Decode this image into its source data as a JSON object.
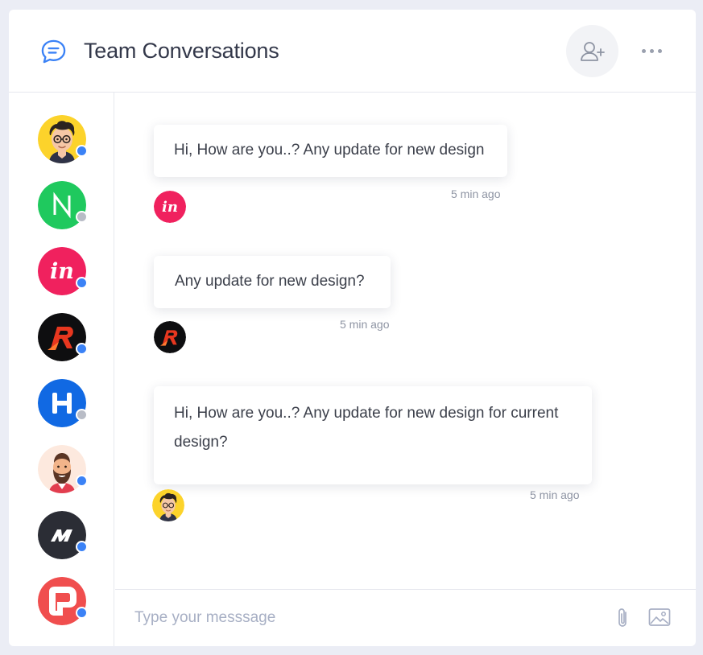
{
  "header": {
    "title": "Team Conversations",
    "icons": {
      "chat": "chat-bubble-icon",
      "add_user": "add-user-icon",
      "more": "more-dots-icon"
    }
  },
  "sidebar": {
    "contacts": [
      {
        "avatar": "cartoon-man-glasses-avatar",
        "status": "online",
        "status_color": "#3b82f6"
      },
      {
        "avatar": "n-logo-avatar",
        "initial": "N",
        "status": "offline",
        "status_color": "#b8bcc6"
      },
      {
        "avatar": "invision-logo-avatar",
        "initial": "in",
        "status": "online",
        "status_color": "#3b82f6"
      },
      {
        "avatar": "r-logo-avatar",
        "initial": "R",
        "status": "online",
        "status_color": "#3b82f6"
      },
      {
        "avatar": "h-logo-avatar",
        "initial": "H",
        "status": "offline",
        "status_color": "#b8bcc6"
      },
      {
        "avatar": "bearded-man-avatar",
        "status": "online",
        "status_color": "#3b82f6"
      },
      {
        "avatar": "m-logo-avatar",
        "initial": "M",
        "status": "online",
        "status_color": "#3b82f6"
      },
      {
        "avatar": "red-p-logo-avatar",
        "status": "online",
        "status_color": "#3b82f6"
      }
    ]
  },
  "messages": [
    {
      "text": "Hi, How are you..? Any update for new design",
      "time": "5 min ago",
      "avatar": "invision-logo-avatar"
    },
    {
      "text": "Any update for new design?",
      "time": "5 min ago",
      "avatar": "r-logo-avatar"
    },
    {
      "text": "Hi, How are you..? Any update for new design for current design?",
      "time": "5 min ago",
      "avatar": "cartoon-man-glasses-avatar"
    }
  ],
  "composer": {
    "placeholder": "Type your messsage",
    "icons": {
      "attach": "paperclip-icon",
      "image": "image-icon"
    }
  },
  "colors": {
    "accent": "#3b82f6",
    "online": "#3b82f6",
    "offline": "#b8bcc6",
    "invision": "#f0215e",
    "n_green": "#1fc95e",
    "h_blue": "#1169e3",
    "m_dark": "#2b2d35",
    "p_red": "#f04e4e"
  }
}
